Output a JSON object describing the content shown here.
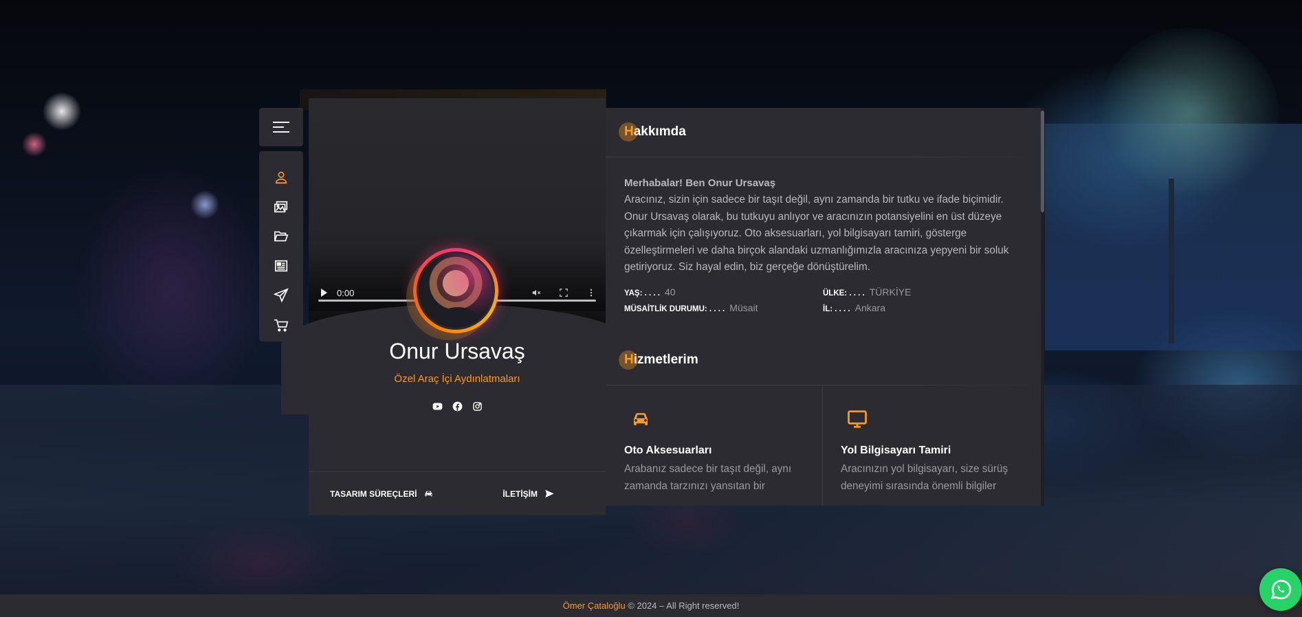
{
  "profile": {
    "name": "Onur Ursavaş",
    "role": "Özel Araç İçi Aydınlatmaları",
    "video_time": "0:00",
    "social_icons": [
      "youtube-icon",
      "facebook-icon",
      "instagram-icon"
    ],
    "buttons": {
      "design": "TASARIM SÜREÇLERİ",
      "contact": "İLETİŞİM"
    }
  },
  "nav": {
    "items": [
      "user-icon",
      "gallery-icon",
      "folder-icon",
      "news-icon",
      "send-icon",
      "cart-icon"
    ],
    "active": 0
  },
  "about": {
    "title_first": "H",
    "title_rest": "akkımda",
    "heading": "Merhabalar! Ben Onur Ursavaş",
    "text": "Aracınız, sizin için sadece bir taşıt değil, aynı zamanda bir tutku ve ifade biçimidir. Onur Ursavaş olarak, bu tutkuyu anlıyor ve aracınızın potansiyelini en üst düzeye çıkarmak için çalışıyoruz. Oto aksesuarları, yol bilgisayarı tamiri, gösterge özelleştirmeleri ve daha birçok alandaki uzmanlığımızla aracınıza yepyeni bir soluk getiriyoruz. Siz hayal edin, biz gerçeğe dönüştürelim.",
    "info": {
      "age_label": "YAŞ: . . . .",
      "age": "40",
      "country_label": "ÜLKE: . . . .",
      "country": "TÜRKİYE",
      "availability_label": "MÜSAİTLİK DURUMU: . . . .",
      "availability": "Müsait",
      "city_label": "İL: . . . .",
      "city": "Ankara"
    }
  },
  "services": {
    "title_first": "H",
    "title_rest": "izmetlerim",
    "items": [
      {
        "icon": "car-icon",
        "title": "Oto Aksesuarları",
        "text": "Arabanız sadece bir taşıt değil, aynı zamanda tarzınızı yansıtan bir"
      },
      {
        "icon": "monitor-icon",
        "title": "Yol Bilgisayarı Tamiri",
        "text": "Aracınızın yol bilgisayarı, size sürüş deneyimi sırasında önemli bilgiler"
      }
    ]
  },
  "footer": {
    "author": "Ömer Çataloğlu",
    "rest": " © 2024 – All Right reserved!"
  },
  "colors": {
    "accent": "#ff9a1a",
    "panel": "#2b2b31",
    "whatsapp": "#25d366"
  }
}
